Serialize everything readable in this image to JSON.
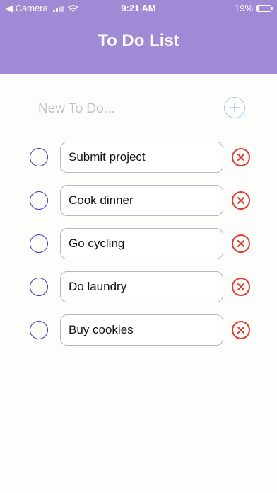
{
  "status_bar": {
    "back_label": "◀ Camera",
    "time": "9:21 AM",
    "battery": "19%",
    "battery_level": 0.19
  },
  "header": {
    "title": "To Do List"
  },
  "new_todo": {
    "placeholder": "New To Do...",
    "value": ""
  },
  "todos": [
    {
      "label": "Submit project",
      "completed": false
    },
    {
      "label": "Cook dinner",
      "completed": false
    },
    {
      "label": "Go cycling",
      "completed": false
    },
    {
      "label": "Do laundry",
      "completed": false
    },
    {
      "label": "Buy cookies",
      "completed": false
    }
  ],
  "icons": {
    "add": "plus-icon",
    "complete": "circle-icon",
    "delete": "x-circle-icon"
  },
  "colors": {
    "header": "#a08ad6",
    "checkbox": "#3b3bc4",
    "delete": "#e03a2e",
    "add": "#9ccde8",
    "background": "#fdfdfb"
  }
}
